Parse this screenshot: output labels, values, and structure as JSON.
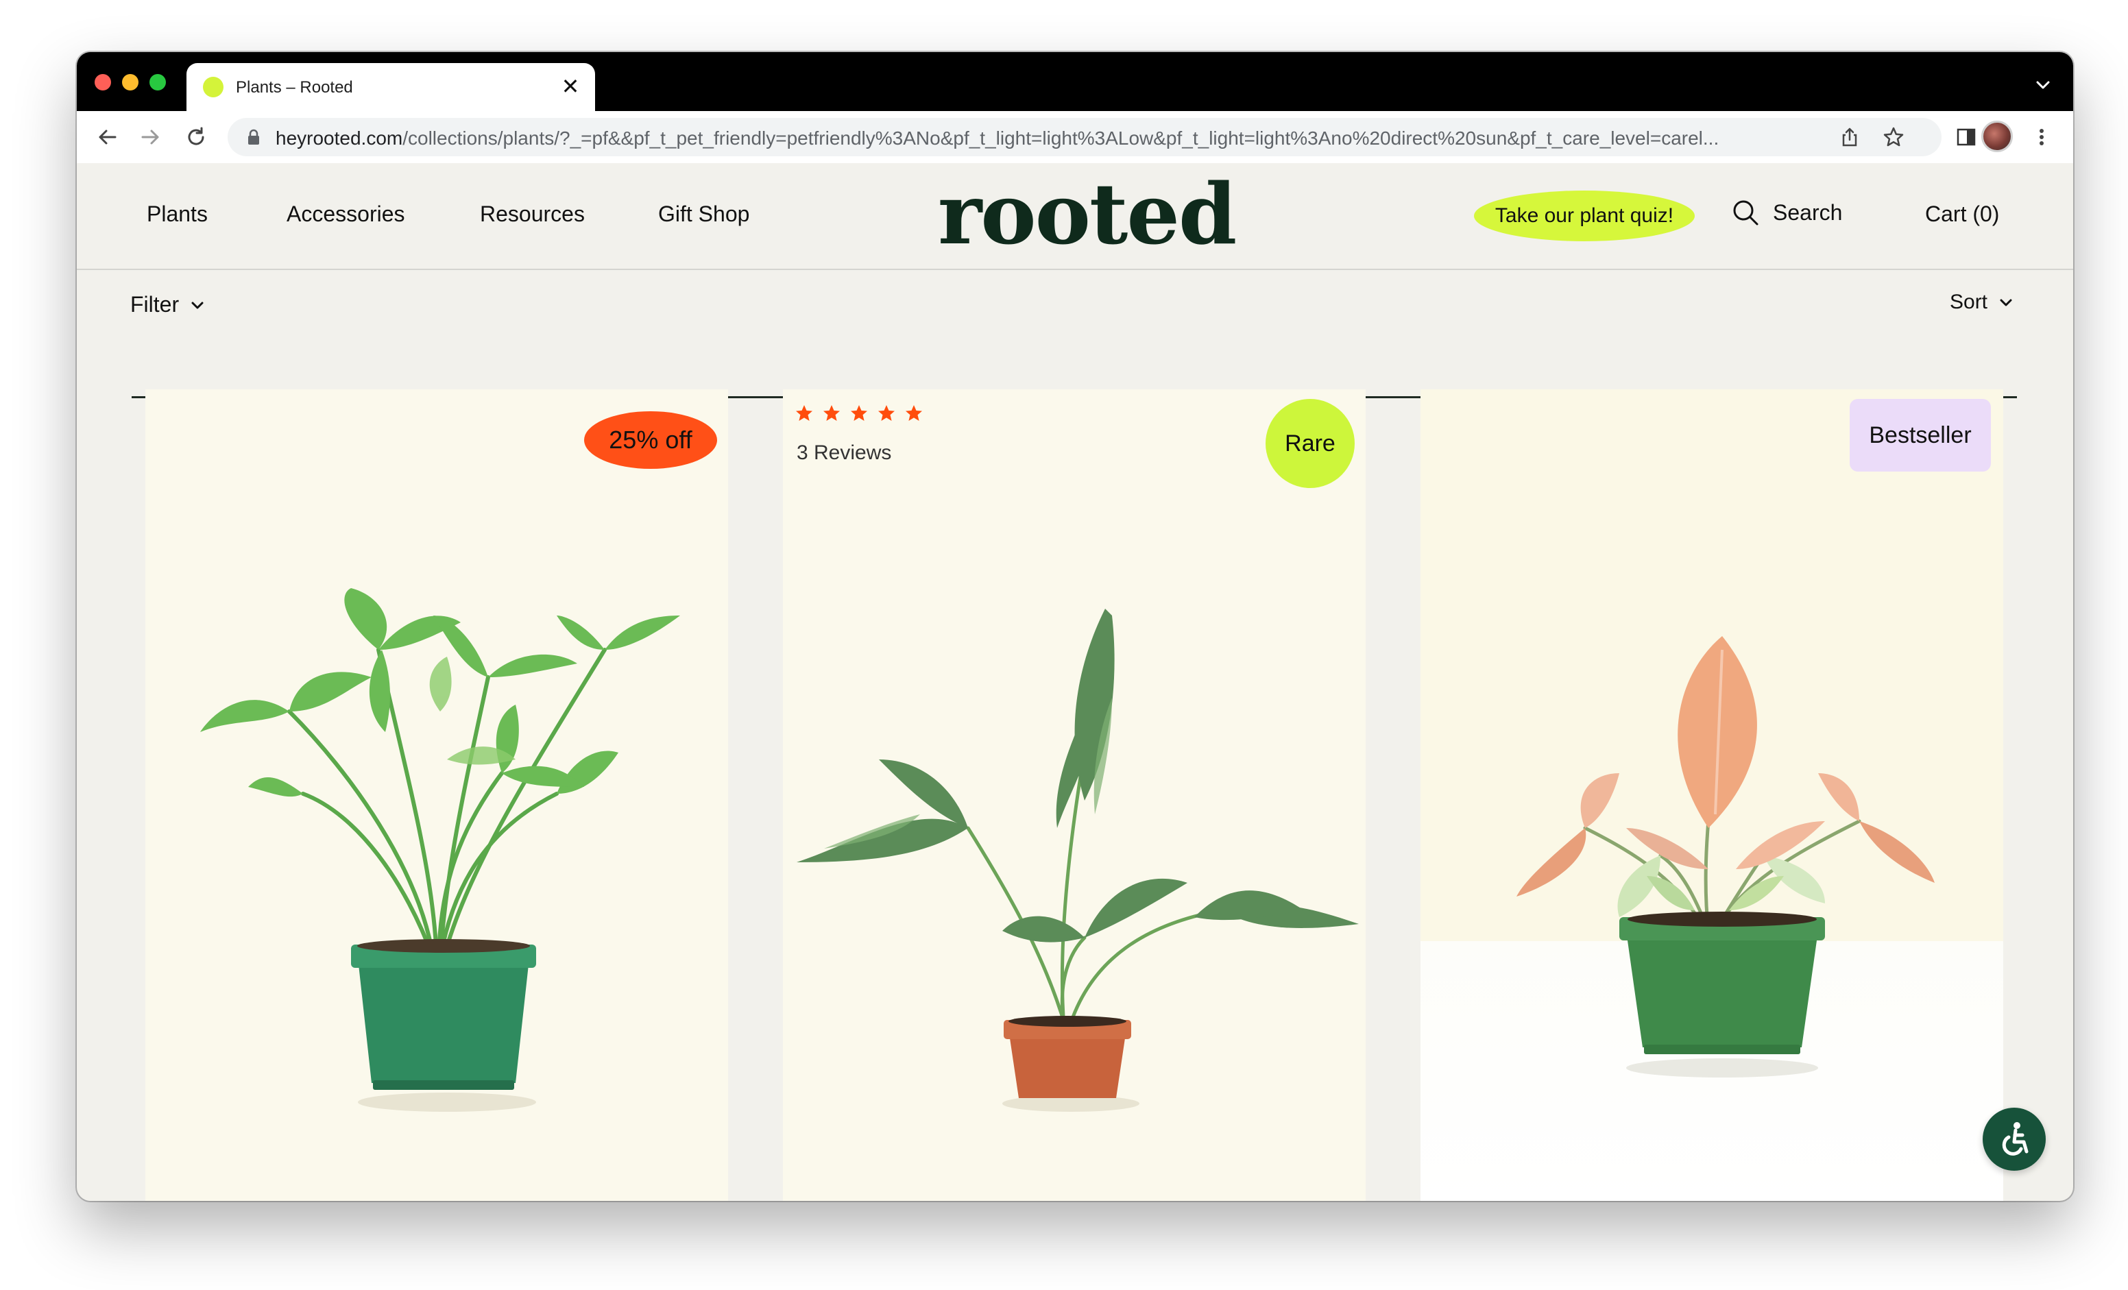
{
  "browser": {
    "tab_title": "Plants – Rooted",
    "tab_close": "✕",
    "new_tab": "+",
    "url_host": "heyrooted.com",
    "url_path": "/collections/plants/?_=pf&&pf_t_pet_friendly=petfriendly%3ANo&pf_t_light=light%3ALow&pf_t_light=light%3Ano%20direct%20sun&pf_t_care_level=carel..."
  },
  "site": {
    "logo": "rooted",
    "nav": [
      "Plants",
      "Accessories",
      "Resources",
      "Gift Shop"
    ],
    "quiz_label": "Take our plant quiz!",
    "search_label": "Search",
    "cart_label": "Cart (0)"
  },
  "filters": {
    "filter_label": "Filter",
    "sort_label": "Sort"
  },
  "products": [
    {
      "badge": "25% off",
      "badge_color": "#ff5017"
    },
    {
      "badge": "Rare",
      "badge_color": "#cdf63b",
      "rating": 5,
      "reviews": "3 Reviews"
    },
    {
      "badge": "Bestseller",
      "badge_color": "#ebdcf9"
    }
  ],
  "colors": {
    "brand_green": "#0f2a1c",
    "accent_lime": "#d6f73b",
    "star_orange": "#ff4d0d",
    "page_bg": "#f2f1ec",
    "card_bg": "#fbf9ec"
  },
  "icons": [
    "back-arrow-icon",
    "forward-arrow-icon",
    "reload-icon",
    "lock-icon",
    "share-icon",
    "star-icon",
    "sidebar-icon",
    "kebab-menu-icon",
    "search-icon",
    "chevron-down-icon",
    "accessibility-icon"
  ]
}
